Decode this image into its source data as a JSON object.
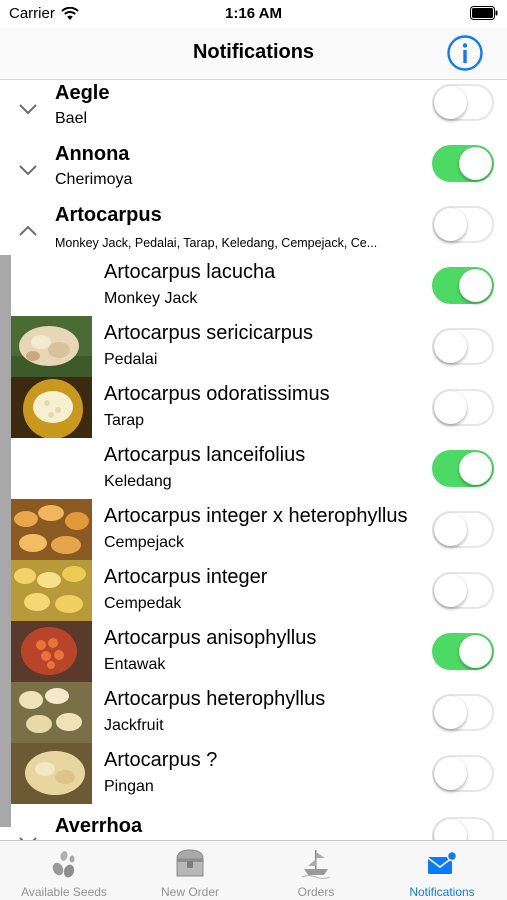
{
  "status_bar": {
    "carrier": "Carrier",
    "time": "1:16 AM"
  },
  "nav": {
    "title": "Notifications"
  },
  "groups": [
    {
      "title": "Aegle",
      "subtitle": "Bael",
      "on": false,
      "expanded": false
    },
    {
      "title": "Annona",
      "subtitle": "Cherimoya",
      "on": true,
      "expanded": false
    },
    {
      "title": "Artocarpus",
      "subtitle": "Monkey Jack, Pedalai, Tarap, Keledang, Cempejack, Ce...",
      "on": false,
      "expanded": true
    },
    {
      "title": "Averrhoa",
      "subtitle": "",
      "on": false,
      "expanded": false
    }
  ],
  "species": [
    {
      "name": "Artocarpus lacucha",
      "common": "Monkey Jack",
      "on": true,
      "thumb": "none"
    },
    {
      "name": "Artocarpus sericicarpus",
      "common": "Pedalai",
      "on": false,
      "thumb": "sericicarpus"
    },
    {
      "name": "Artocarpus odoratissimus",
      "common": "Tarap",
      "on": false,
      "thumb": "odoratissimus"
    },
    {
      "name": "Artocarpus lanceifolius",
      "common": "Keledang",
      "on": true,
      "thumb": "none"
    },
    {
      "name": "Artocarpus integer x heterophyllus",
      "common": "Cempejack",
      "on": false,
      "thumb": "cempejack"
    },
    {
      "name": "Artocarpus integer",
      "common": "Cempedak",
      "on": false,
      "thumb": "cempedak"
    },
    {
      "name": "Artocarpus anisophyllus",
      "common": "Entawak",
      "on": true,
      "thumb": "entawak"
    },
    {
      "name": "Artocarpus heterophyllus",
      "common": "Jackfruit",
      "on": false,
      "thumb": "jackfruit"
    },
    {
      "name": "Artocarpus ?",
      "common": "Pingan",
      "on": false,
      "thumb": "pingan"
    }
  ],
  "tabs": [
    {
      "label": "Available Seeds",
      "icon": "seeds-icon",
      "active": false
    },
    {
      "label": "New Order",
      "icon": "chest-icon",
      "active": false
    },
    {
      "label": "Orders",
      "icon": "ship-icon",
      "active": false
    },
    {
      "label": "Notifications",
      "icon": "mail-badge-icon",
      "active": true
    }
  ],
  "colors": {
    "accent": "#0a7aff",
    "switch_on": "#4cd964",
    "switch_off_border": "#e5e5ea"
  }
}
